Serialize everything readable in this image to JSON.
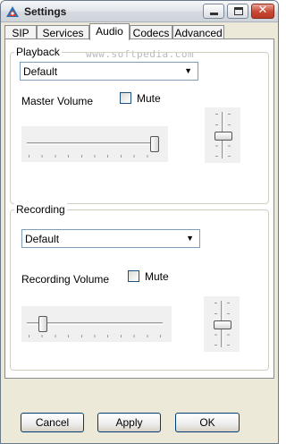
{
  "window": {
    "title": "Settings"
  },
  "title_buttons": [
    "minimize",
    "maximize",
    "close"
  ],
  "close_glyph": "✕",
  "tabs": [
    {
      "label": "SIP",
      "active": false
    },
    {
      "label": "Services",
      "active": false
    },
    {
      "label": "Audio",
      "active": true
    },
    {
      "label": "Codecs",
      "active": false
    },
    {
      "label": "Advanced",
      "active": false
    }
  ],
  "watermark": "www.softpedia.com",
  "playback": {
    "group_label": "Playback",
    "device": "Default",
    "volume_label": "Master Volume",
    "mute_label": "Mute",
    "mute_checked": false,
    "volume_level": 0.96,
    "balance_level": 0.5
  },
  "recording": {
    "group_label": "Recording",
    "device": "Default",
    "volume_label": "Recording Volume",
    "mute_label": "Mute",
    "mute_checked": false,
    "volume_level": 0.1,
    "balance_level": 0.5
  },
  "buttons": {
    "cancel": "Cancel",
    "apply": "Apply",
    "ok": "OK"
  },
  "colors": {
    "tab_panel_bg": "#ffffff",
    "window_bg": "#ece9d8",
    "close_red": "#c84b36"
  }
}
